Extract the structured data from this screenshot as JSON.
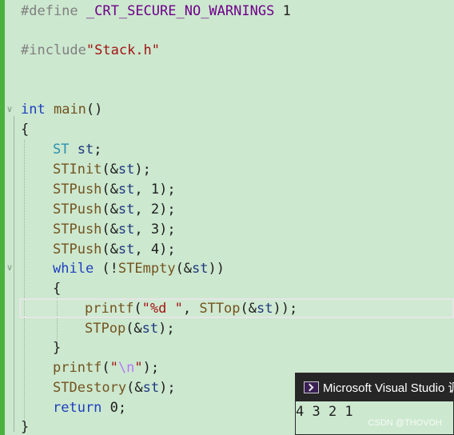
{
  "editor": {
    "line1": {
      "pp": "#define",
      "macro": "_CRT_SECURE_NO_WARNINGS",
      "val": "1"
    },
    "line2": {
      "pp": "#include",
      "file": "\"Stack.h\""
    },
    "line3": {
      "kw": "int",
      "fn": "main",
      "rest": "()"
    },
    "line4": "{",
    "line5": {
      "type": "ST",
      "var": "st",
      "end": ";"
    },
    "line6": {
      "fn": "STInit",
      "open": "(&",
      "var": "st",
      "close": ");"
    },
    "line7": {
      "fn": "STPush",
      "open": "(&",
      "var": "st",
      "arg": ", 1);"
    },
    "line8": {
      "fn": "STPush",
      "open": "(&",
      "var": "st",
      "arg": ", 2);"
    },
    "line9": {
      "fn": "STPush",
      "open": "(&",
      "var": "st",
      "arg": ", 3);"
    },
    "line10": {
      "fn": "STPush",
      "open": "(&",
      "var": "st",
      "arg": ", 4);"
    },
    "line11": {
      "kw": "while",
      "open": " (!",
      "fn": "STEmpty",
      "open2": "(&",
      "var": "st",
      "close": "))"
    },
    "line12": "{",
    "line13": {
      "fn": "printf",
      "open": "(",
      "str": "\"%d \"",
      "mid": ", ",
      "fn2": "STTop",
      "open2": "(&",
      "var": "st",
      "close": "));"
    },
    "line14": {
      "fn": "STPop",
      "open": "(&",
      "var": "st",
      "close": ");"
    },
    "line15": "}",
    "line16": {
      "fn": "printf",
      "open": "(",
      "q1": "\"",
      "esc": "\\n",
      "q2": "\"",
      "close": ");"
    },
    "line17": {
      "fn": "STDestory",
      "open": "(&",
      "var": "st",
      "close": ");"
    },
    "line18": {
      "kw": "return",
      "rest": " 0;"
    },
    "line19": "}"
  },
  "console": {
    "title": "Microsoft Visual Studio 调",
    "output": "4 3 2 1",
    "watermark": "CSDN @THOVOH"
  },
  "colors": {
    "background": "#cce8cf",
    "keyword": "#1f3fbf",
    "type": "#2b91af",
    "function": "#74531f",
    "macro": "#6f008a",
    "string": "#a31515",
    "escape": "#b776fb",
    "variable": "#1f377f",
    "preprocessor": "#808080",
    "change_bar": "#4bb241"
  }
}
